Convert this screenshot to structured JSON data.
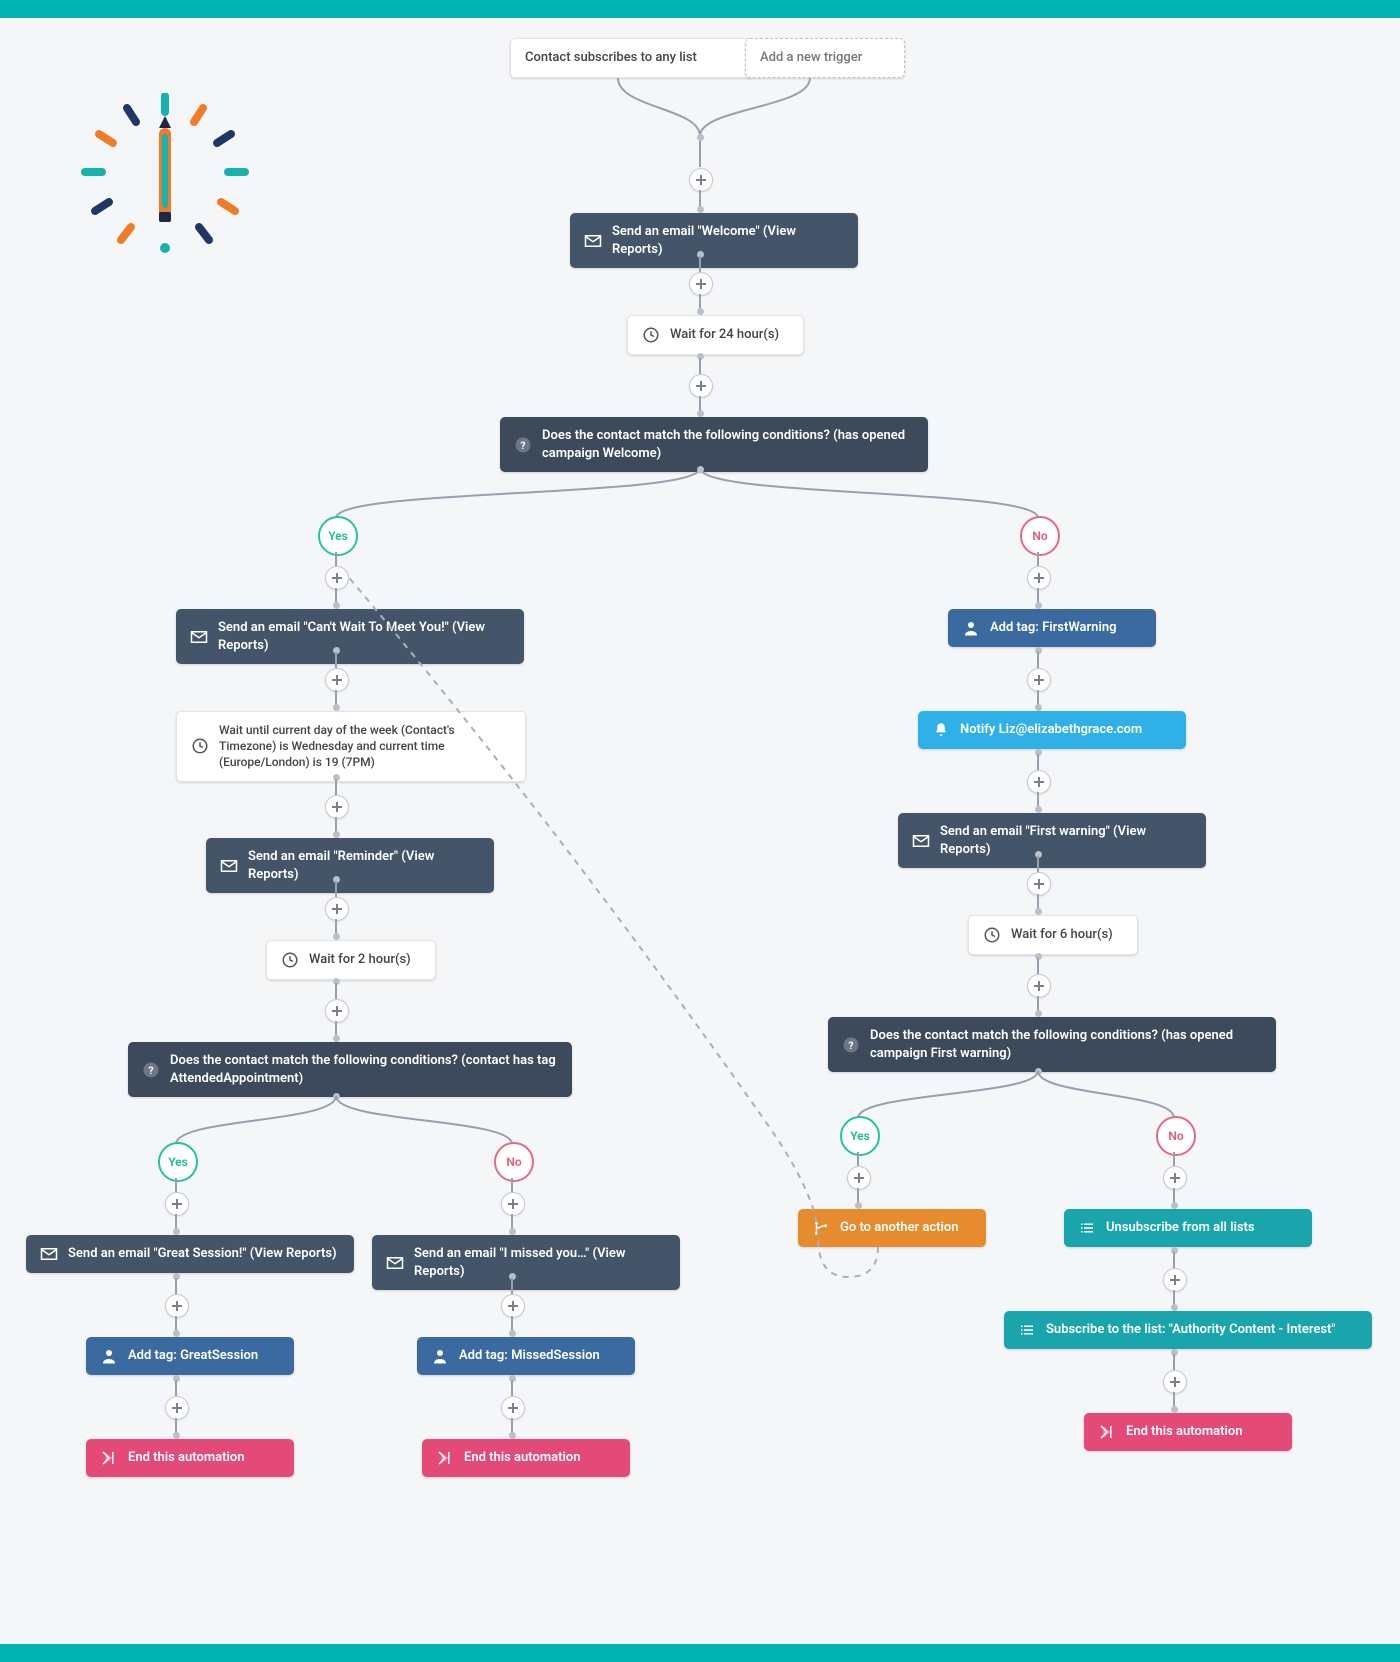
{
  "trigger": {
    "start": "Contact subscribes to any list",
    "add": "Add a new trigger"
  },
  "a": {
    "welcome": "Send an email \"Welcome\" (View Reports)",
    "wait24": "Wait for 24 hour(s)"
  },
  "cond1": "Does the contact match the following conditions? (has opened campaign Welcome)",
  "yes": "Yes",
  "no": "No",
  "L": {
    "email2": "Send an email \"Can't Wait To Meet You!\" (View Reports)",
    "waitDay": "Wait until current day of the week (Contact's Timezone) is Wednesday and current time (Europe/London) is 19 (7PM)",
    "reminder": "Send an email \"Reminder\" (View Reports)",
    "wait2": "Wait for 2 hour(s)",
    "cond": "Does the contact match the following conditions? (contact has tag AttendedAppointment)",
    "great": "Send an email \"Great Session!\" (View Reports)",
    "tagGreat": "Add tag: GreatSession",
    "missed": "Send an email \"I missed you…\" (View Reports)",
    "tagMissed": "Add tag: MissedSession",
    "end": "End this automation"
  },
  "R": {
    "tagWarn": "Add tag: FirstWarning",
    "notify": "Notify Liz@elizabethgrace.com",
    "firstWarn": "Send an email \"First warning\" (View Reports)",
    "wait6": "Wait for 6 hour(s)",
    "cond": "Does the contact match the following conditions? (has opened campaign First warning)",
    "goto": "Go to another action",
    "unsub": "Unsubscribe from all lists",
    "sub": "Subscribe to the list: \"Authority Content - Interest\"",
    "end": "End this automation"
  }
}
